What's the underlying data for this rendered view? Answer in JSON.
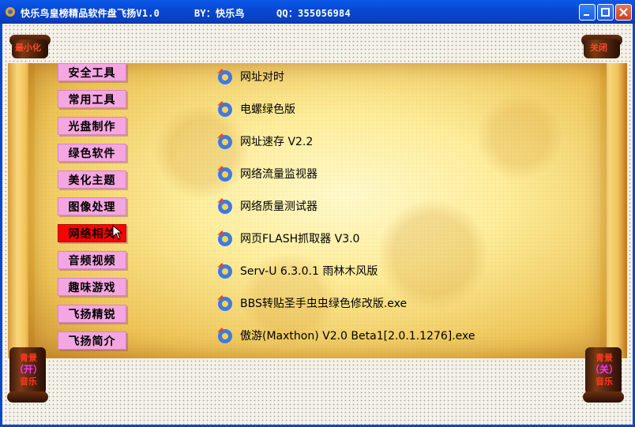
{
  "window": {
    "title_name": "快乐鸟皇榜精品软件盘飞扬V1.0",
    "title_by": "BY：快乐鸟",
    "title_qq": "QQ：355056984"
  },
  "controls": {
    "minimize_label": "最小化",
    "close_label": "关闭",
    "music_on": [
      "青景",
      "（开）",
      "音乐"
    ],
    "music_off": [
      "青景",
      "（关）",
      "音乐"
    ]
  },
  "categories": [
    {
      "label": "安全工具"
    },
    {
      "label": "常用工具"
    },
    {
      "label": "光盘制作"
    },
    {
      "label": "绿色软件"
    },
    {
      "label": "美化主题"
    },
    {
      "label": "图像处理"
    },
    {
      "label": "网络相关",
      "active": true
    },
    {
      "label": "音频视频"
    },
    {
      "label": "趣味游戏"
    },
    {
      "label": "飞扬精锐"
    },
    {
      "label": "飞扬简介"
    }
  ],
  "items": [
    {
      "label": "网址对时"
    },
    {
      "label": "电螺绿色版"
    },
    {
      "label": "网址速存 V2.2"
    },
    {
      "label": "网络流量监视器"
    },
    {
      "label": "网络质量测试器"
    },
    {
      "label": "网页FLASH抓取器 V3.0"
    },
    {
      "label": "Serv-U 6.3.0.1 雨林木风版"
    },
    {
      "label": "BBS转贴圣手虫虫绿色修改版.exe"
    },
    {
      "label": "傲游(Maxthon) V2.0 Beta1[2.0.1.1276].exe"
    }
  ],
  "colors": {
    "category_bg": "#f4a6e0",
    "category_active_bg": "#ff0000",
    "titlebar": "#0a48d4",
    "scroll_gold": "#f2c35a"
  }
}
